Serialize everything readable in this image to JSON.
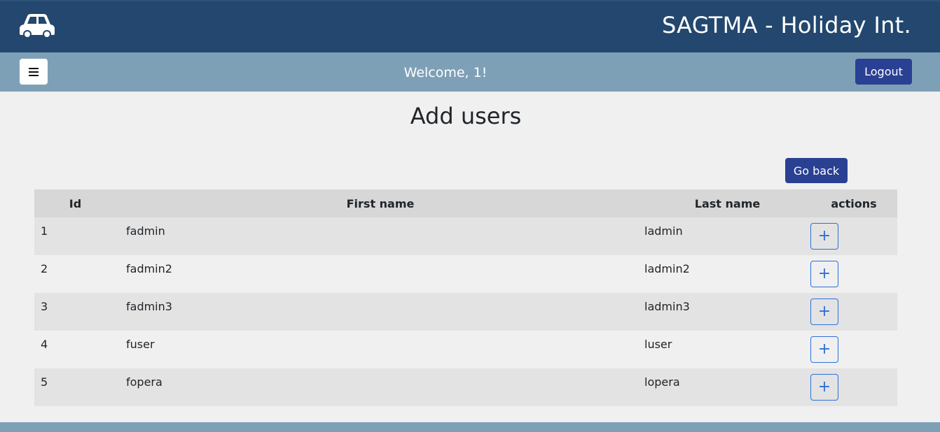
{
  "header": {
    "brand_title": "SAGTMA - Holiday Int.",
    "logo_icon": "car-icon"
  },
  "navbar": {
    "menu_icon": "hamburger-menu-icon",
    "welcome_text": "Welcome, 1!",
    "logout_label": "Logout"
  },
  "page": {
    "title": "Add users",
    "go_back_label": "Go back"
  },
  "table": {
    "columns": [
      "Id",
      "First name",
      "Last name",
      "actions"
    ],
    "rows": [
      {
        "id": "1",
        "first_name": "fadmin",
        "last_name": "ladmin",
        "action": "+"
      },
      {
        "id": "2",
        "first_name": "fadmin2",
        "last_name": "ladmin2",
        "action": "+"
      },
      {
        "id": "3",
        "first_name": "fadmin3",
        "last_name": "ladmin3",
        "action": "+"
      },
      {
        "id": "4",
        "first_name": "fuser",
        "last_name": "luser",
        "action": "+"
      },
      {
        "id": "5",
        "first_name": "fopera",
        "last_name": "lopera",
        "action": "+"
      }
    ]
  },
  "colors": {
    "header_bg": "#23476e",
    "navbar_bg": "#7ea0b7",
    "primary_button": "#2a4093",
    "action_outline": "#2e6fd8"
  }
}
